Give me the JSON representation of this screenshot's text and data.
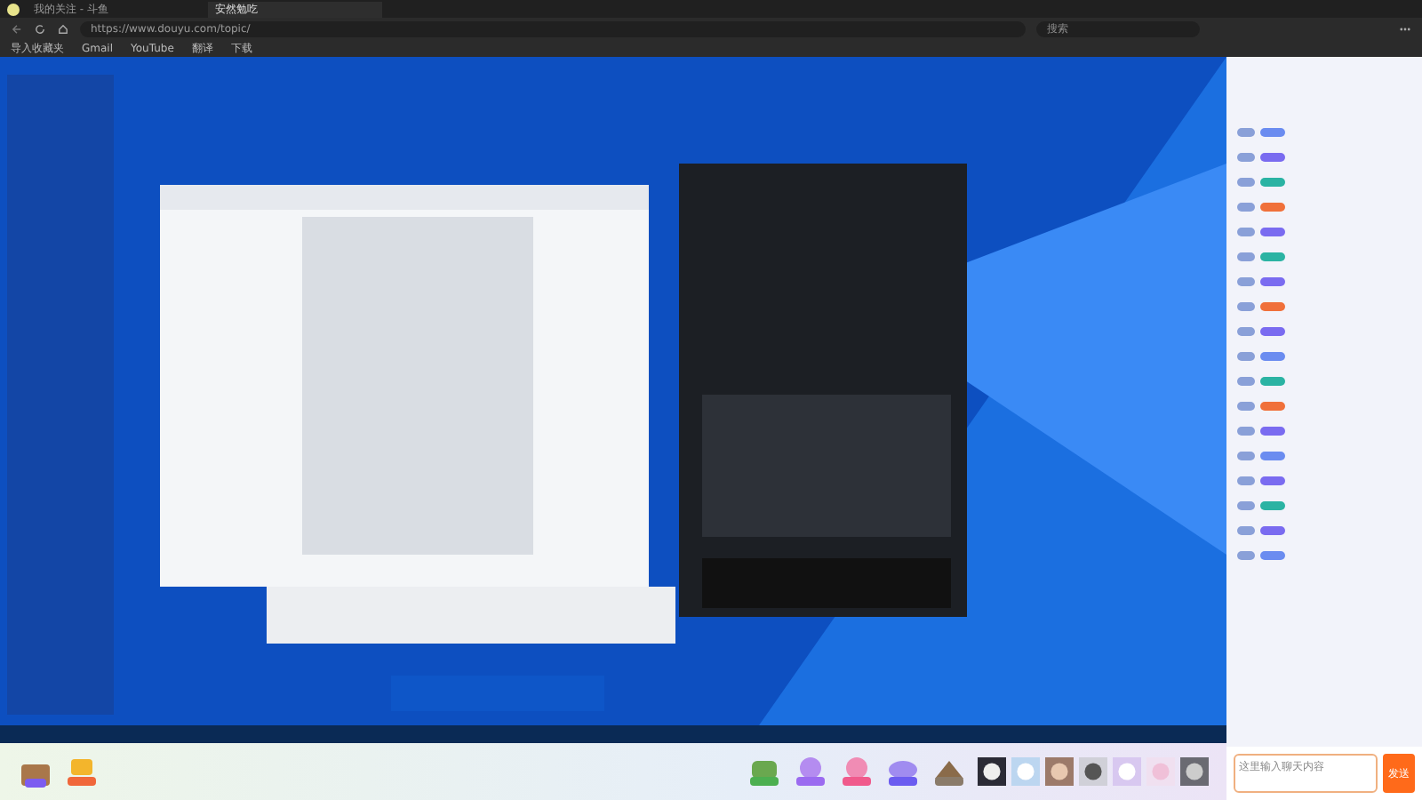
{
  "browser": {
    "tabs": [
      {
        "title": "我的关注 - 斗鱼",
        "selected": false
      },
      {
        "title": "安然勉吃",
        "selected": true
      }
    ],
    "address": "https://www.douyu.com/topic/",
    "search_placeholder": "搜索",
    "bookmarks": [
      "导入收藏夹",
      "Gmail",
      "YouTube",
      "翻译",
      "下载"
    ]
  },
  "chat": {
    "messages": [
      {
        "color": "#6b8cf0"
      },
      {
        "color": "#7a6bf0"
      },
      {
        "color": "#2bb3a3"
      },
      {
        "color": "#f0703a"
      },
      {
        "color": "#7a6bf0"
      },
      {
        "color": "#2bb3a3"
      },
      {
        "color": "#7a6bf0"
      },
      {
        "color": "#f0703a"
      },
      {
        "color": "#7a6bf0"
      },
      {
        "color": "#6b8cf0"
      },
      {
        "color": "#2bb3a3"
      },
      {
        "color": "#f0703a"
      },
      {
        "color": "#7a6bf0"
      },
      {
        "color": "#6b8cf0"
      },
      {
        "color": "#7a6bf0"
      },
      {
        "color": "#2bb3a3"
      },
      {
        "color": "#7a6bf0"
      },
      {
        "color": "#6b8cf0"
      }
    ],
    "input_placeholder": "这里输入聊天内容",
    "send": "发送"
  }
}
